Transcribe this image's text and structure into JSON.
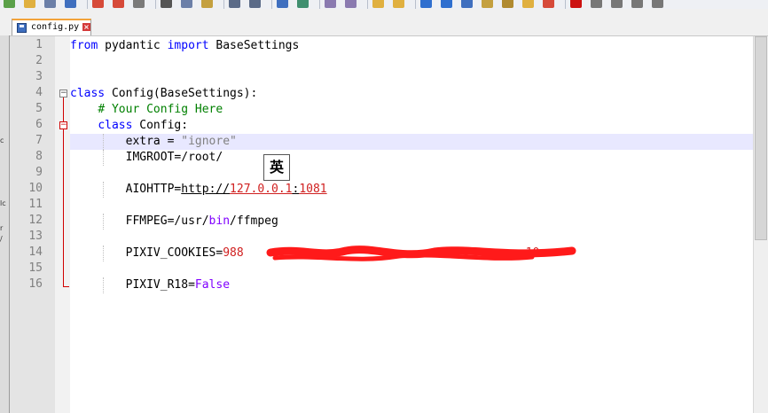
{
  "toolbar": {
    "buttons": [
      "new-file-icon",
      "open-file-icon",
      "save-icon",
      "save-all-icon",
      "close-icon",
      "close-all-icon",
      "print-icon",
      "cut-icon",
      "copy-icon",
      "paste-icon",
      "undo-icon",
      "redo-icon",
      "find-icon",
      "replace-icon",
      "zoom-in-icon",
      "zoom-out-icon",
      "sync-v-icon",
      "sync-h-icon",
      "word-wrap-icon",
      "all-chars-icon",
      "indent-guide-icon",
      "doc-map-icon",
      "function-list-icon",
      "folder-workspace-icon",
      "monitor-icon",
      "record-macro-icon",
      "stop-macro-icon",
      "play-macro-icon",
      "run-macro-icon",
      "save-macro-icon"
    ]
  },
  "tab": {
    "label": "config.py"
  },
  "left_strip": {
    "chars": [
      "c",
      "lc",
      "r",
      "/"
    ]
  },
  "editor": {
    "line_numbers": [
      "1",
      "2",
      "3",
      "4",
      "5",
      "6",
      "7",
      "8",
      "9",
      "10",
      "11",
      "12",
      "13",
      "14",
      "15",
      "16"
    ],
    "lines": {
      "l1": {
        "kw_from": "from",
        "mod": " pydantic ",
        "kw_import": "import",
        "name": " BaseSettings"
      },
      "l4": {
        "kw_class": "class",
        "rest": " Config(BaseSettings):"
      },
      "l5": {
        "comment": "# Your Config Here"
      },
      "l6": {
        "kw_class": "class",
        "rest": " Config:"
      },
      "l7": {
        "key": "extra = ",
        "value": "\"ignore\""
      },
      "l8": {
        "text": "IMGROOT=/root/"
      },
      "l10": {
        "key": "AIOHTTP=",
        "scheme": "http",
        "sep": "://",
        "host": "127.0.0.1",
        "colon": ":",
        "port": "1081"
      },
      "l12": {
        "pre": "FFMPEG=/usr/",
        "bin": "bin",
        "post": "/ffmpeg"
      },
      "l14": {
        "key": "PIXIV_COOKIES=",
        "visible_start": "988",
        "visible_end": "10"
      },
      "l16": {
        "key": "PIXIV_R18=",
        "value": "False"
      }
    }
  },
  "ime": {
    "label": "英"
  },
  "colors": {
    "keyword": "#0000ff",
    "keyword2": "#8000ff",
    "comment": "#008000",
    "string": "#808080",
    "number": "#d02020",
    "current_line": "#e8e8ff",
    "redaction": "#ff1a1a"
  }
}
